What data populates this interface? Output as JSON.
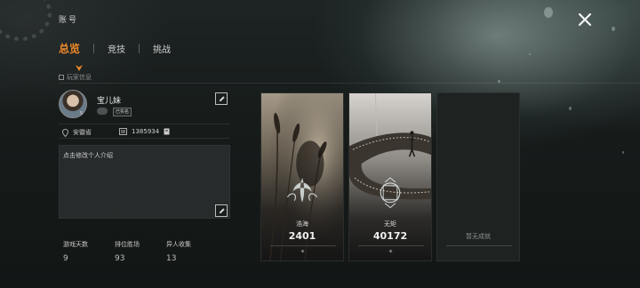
{
  "header": {
    "title": "账号",
    "close_icon": "close-icon"
  },
  "tabs": [
    {
      "label": "总览",
      "active": true
    },
    {
      "label": "竞技",
      "active": false
    },
    {
      "label": "挑战",
      "active": false
    }
  ],
  "section": {
    "label": "玩家信息"
  },
  "profile": {
    "nickname": "宝儿妹",
    "level": "5",
    "tag": "已实名",
    "location": "安徽省",
    "id": "1385934",
    "bio_placeholder": "点击修改个人介绍"
  },
  "stats": [
    {
      "label": "游戏天数",
      "value": "9"
    },
    {
      "label": "排位胜场",
      "value": "93"
    },
    {
      "label": "异人收集",
      "value": "13"
    }
  ],
  "achievements": [
    {
      "name": "浩海",
      "value": "2401"
    },
    {
      "name": "无矩",
      "value": "40172"
    },
    {
      "empty_text": "暂无成就"
    }
  ],
  "colors": {
    "accent": "#f08a2a",
    "background": "#151a19"
  }
}
